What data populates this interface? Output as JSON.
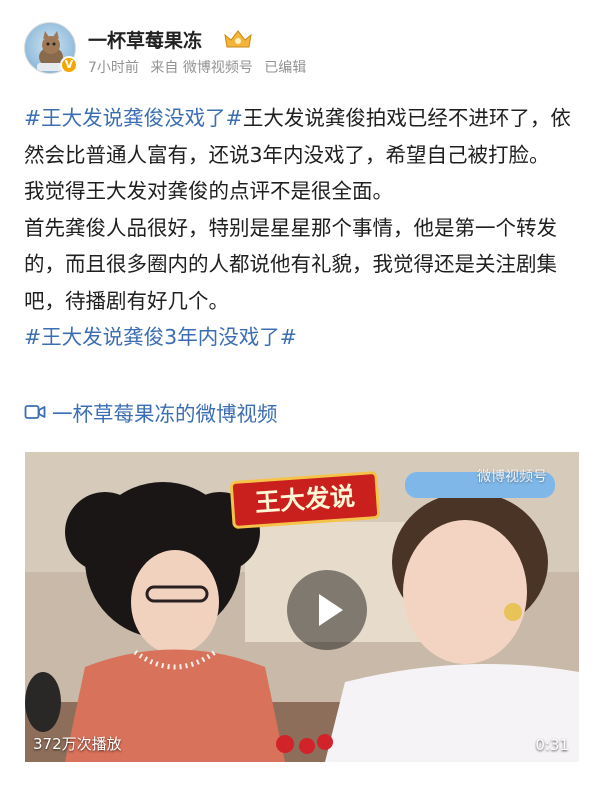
{
  "header": {
    "username": "一杯草莓果冻",
    "meta": {
      "time": "7小时前",
      "source": "来自 微博视频号",
      "edited": "已编辑"
    }
  },
  "post": {
    "hashtag1": "#王大发说龚俊没戏了#",
    "line1_rest": "王大发说龚俊拍戏已经不进环了，依然会比普通人富有，还说3年内没戏了，希望自己被打脸。",
    "para2": "我觉得王大发对龚俊的点评不是很全面。",
    "para3": "首先龚俊人品很好，特别是星星那个事情，他是第一个转发的，而且很多圈内的人都说他有礼貌，我觉得还是关注剧集吧，待播剧有好几个。",
    "hashtag2": "#王大发说龚俊3年内没戏了#",
    "video_link": "一杯草莓果冻的微博视频"
  },
  "video": {
    "watermark": "微博视频号",
    "show_title": "王大发说",
    "play_count": "372万次播放",
    "duration": "0:31"
  },
  "colors": {
    "link": "#3b6eb3",
    "text": "#1f1f1f",
    "meta": "#939393",
    "badge": "#f7a600"
  },
  "icons": {
    "verified": "verified-badge-icon",
    "vip": "vip-crown-icon",
    "video": "video-camera-icon",
    "play": "play-icon"
  }
}
